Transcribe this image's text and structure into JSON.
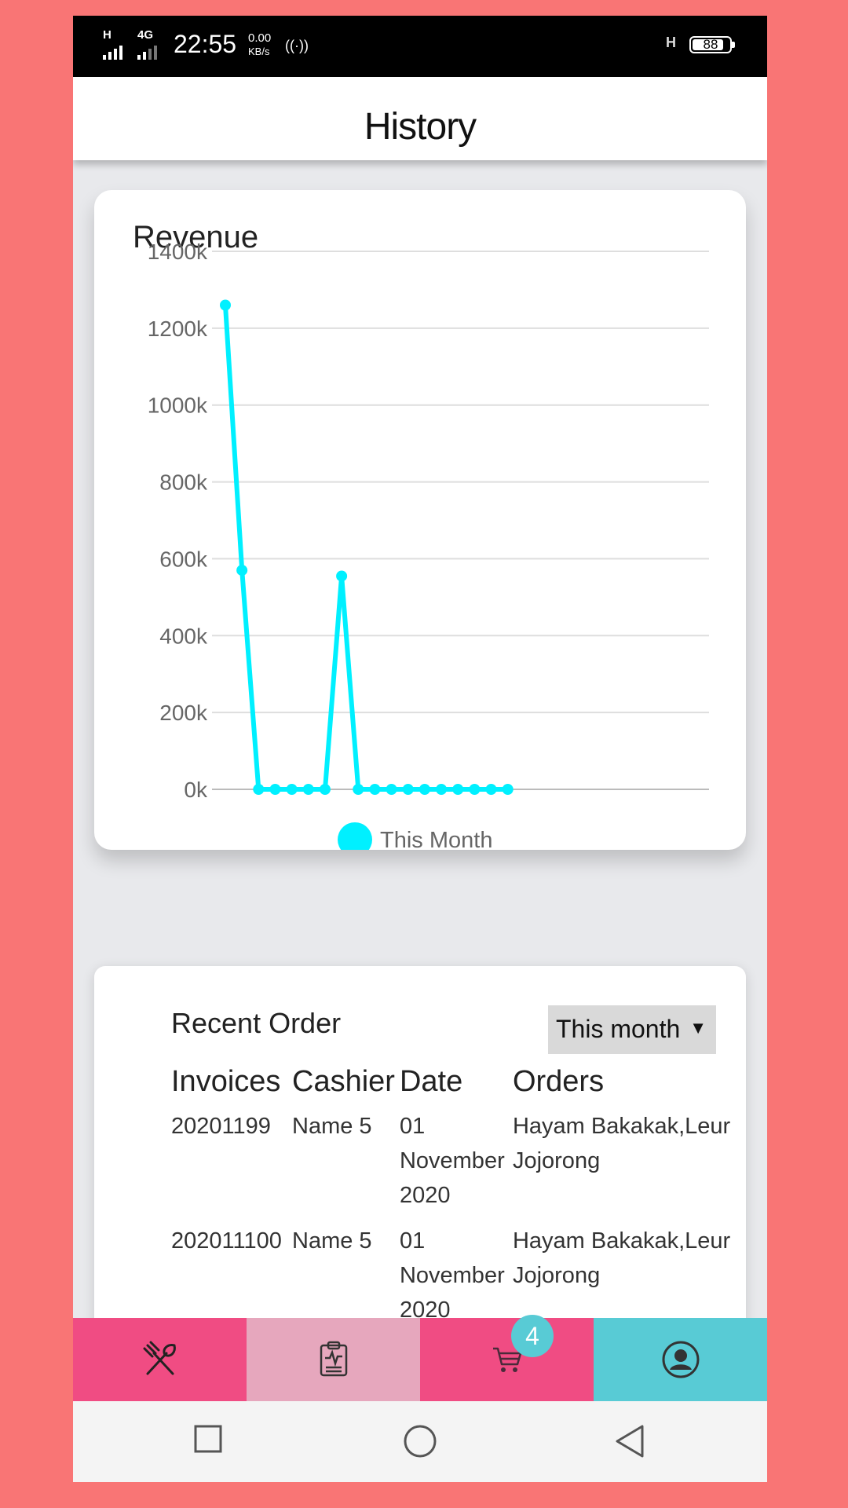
{
  "status_bar": {
    "signal1_label": "H",
    "signal2_label": "4G",
    "time": "22:55",
    "speed_value": "0.00",
    "speed_unit": "KB/s",
    "net2_label": "H",
    "battery": "88",
    "battery_level_percent": 88
  },
  "header": {
    "title": "History"
  },
  "revenue": {
    "title": "Revenue",
    "legend": "This Month",
    "color": "#00f0ff"
  },
  "chart_data": {
    "type": "line",
    "title": "Revenue",
    "ylim": [
      0,
      1400
    ],
    "ytick_labels": [
      "1400k",
      "1200k",
      "1000k",
      "800k",
      "600k",
      "400k",
      "200k",
      "0k"
    ],
    "yticks": [
      1400,
      1200,
      1000,
      800,
      600,
      400,
      200,
      0
    ],
    "grid": true,
    "legend_placement": "bottom",
    "x_count": 31,
    "series": [
      {
        "name": "This Month",
        "values": [
          1260,
          570,
          0,
          0,
          0,
          0,
          0,
          555,
          0,
          0,
          0,
          0,
          0,
          0,
          0,
          0,
          0,
          0
        ]
      }
    ]
  },
  "orders": {
    "title": "Recent Order",
    "period": "This month",
    "headers": [
      "Invoices",
      "Cashier",
      "Date",
      "Orders"
    ],
    "rows": [
      {
        "invoice": "20201199",
        "cashier": "Name 5",
        "date": [
          "01",
          "November",
          "2020"
        ],
        "orders": [
          "Hayam Bakakak,Leur",
          "Jojorong"
        ]
      },
      {
        "invoice": "202011100",
        "cashier": "Name 5",
        "date": [
          "01",
          "November",
          "2020"
        ],
        "orders": [
          "Hayam Bakakak,Leur",
          "Jojorong"
        ]
      }
    ]
  },
  "bottom_nav": {
    "items": [
      {
        "icon": "utensils-icon",
        "color": "#f04c83"
      },
      {
        "icon": "clipboard-icon",
        "color": "#e6a7bd"
      },
      {
        "icon": "cart-icon",
        "color": "#f04c83"
      },
      {
        "icon": "user-icon",
        "color": "#58cbd5"
      }
    ],
    "cart_badge": "4"
  },
  "system_nav": {
    "icons": [
      "recent-apps-icon",
      "home-icon",
      "back-icon"
    ]
  }
}
